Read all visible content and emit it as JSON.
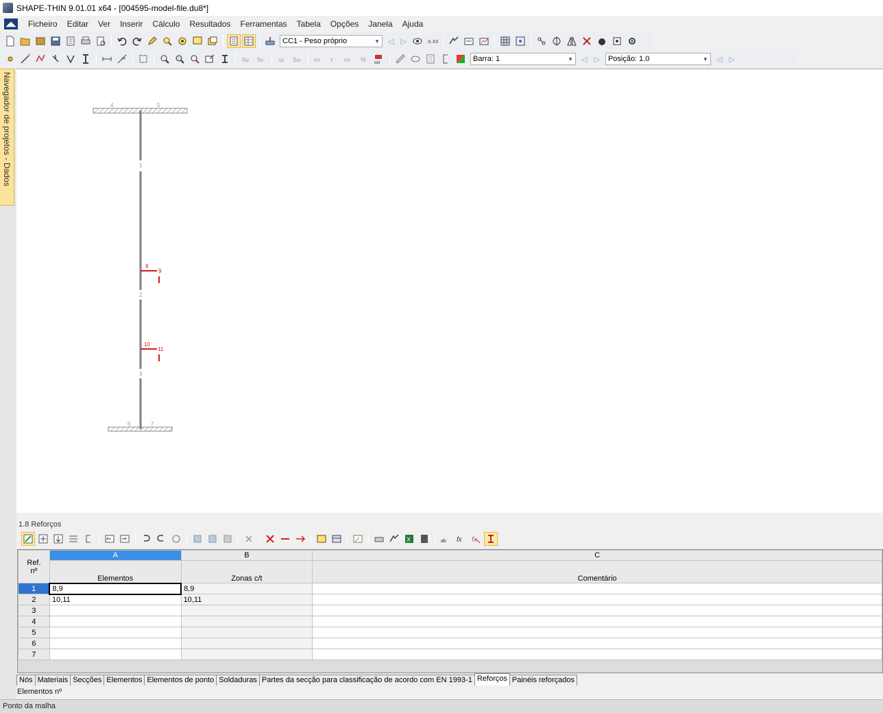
{
  "window": {
    "title": "SHAPE-THIN 9.01.01 x64 - [004595-model-file.du8*]"
  },
  "menu": [
    "Ficheiro",
    "Editar",
    "Ver",
    "Inserir",
    "Cálculo",
    "Resultados",
    "Ferramentas",
    "Tabela",
    "Opções",
    "Janela",
    "Ajuda"
  ],
  "toolbar": {
    "load_case": "CC1 - Peso próprio",
    "member": "Barra: 1",
    "position": "Posição: 1.0"
  },
  "sidebar": {
    "navigator_label": "Navegador de projetos - Dados"
  },
  "canvas": {
    "node_labels": [
      "4",
      "5",
      "1",
      "8",
      "9",
      "2",
      "10",
      "11",
      "3",
      "6",
      "7"
    ],
    "colors": {
      "section": "#7f7f7f",
      "stiffener": "#d11b1b",
      "hatch": "#9a9a9a"
    }
  },
  "panel": {
    "title": "1.8 Reforços",
    "columns": {
      "row_header": "Ref. nº",
      "a_letter": "A",
      "a_label": "Elementos",
      "b_letter": "B",
      "b_label": "Zonas c/t",
      "c_letter": "C",
      "c_label": "Comentário"
    },
    "rows": [
      {
        "n": "1",
        "elements": "8,9",
        "zones": "8,9",
        "comment": ""
      },
      {
        "n": "2",
        "elements": "10,11",
        "zones": "10,11",
        "comment": ""
      },
      {
        "n": "3",
        "elements": "",
        "zones": "",
        "comment": ""
      },
      {
        "n": "4",
        "elements": "",
        "zones": "",
        "comment": ""
      },
      {
        "n": "5",
        "elements": "",
        "zones": "",
        "comment": ""
      },
      {
        "n": "6",
        "elements": "",
        "zones": "",
        "comment": ""
      },
      {
        "n": "7",
        "elements": "",
        "zones": "",
        "comment": ""
      }
    ],
    "tabs": [
      "Nós",
      "Materiais",
      "Secções",
      "Elementos",
      "Elementos de ponto",
      "Soldaduras",
      "Partes da secção para classificação de acordo com EN 1993-1",
      "Reforços",
      "Painéis reforçados"
    ],
    "active_tab": "Reforços",
    "field_hint": "Elementos nº"
  },
  "status": {
    "text": "Ponto da malha"
  }
}
